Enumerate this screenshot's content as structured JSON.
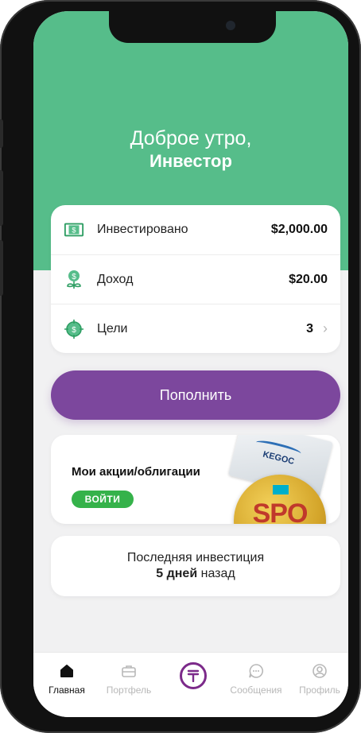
{
  "greeting": {
    "line1": "Доброе утро,",
    "line2": "Инвестор"
  },
  "stats": [
    {
      "label": "Инвестировано",
      "value": "$2,000.00",
      "icon": "cash-icon"
    },
    {
      "label": "Доход",
      "value": "$20.00",
      "icon": "money-plant-icon"
    },
    {
      "label": "Цели",
      "value": "3",
      "icon": "target-dollar-icon"
    }
  ],
  "topup_button": "Пополнить",
  "promo": {
    "title": "Мои акции/облигации",
    "login": "ВОЙТИ",
    "flag_text": "KEGOC",
    "coin_text": "SPO"
  },
  "last_investment": {
    "label": "Последняя инвестиция",
    "days": "5 дней",
    "suffix": "назад"
  },
  "tabs": [
    {
      "label": "Главная",
      "icon": "home-icon"
    },
    {
      "label": "Портфель",
      "icon": "briefcase-icon"
    },
    {
      "label": "",
      "icon": "tenge-icon"
    },
    {
      "label": "Сообщения",
      "icon": "chat-icon"
    },
    {
      "label": "Профиль",
      "icon": "profile-icon"
    }
  ],
  "colors": {
    "green": "#56bd8a",
    "purple": "#7c479d",
    "login_green": "#35b24a"
  }
}
